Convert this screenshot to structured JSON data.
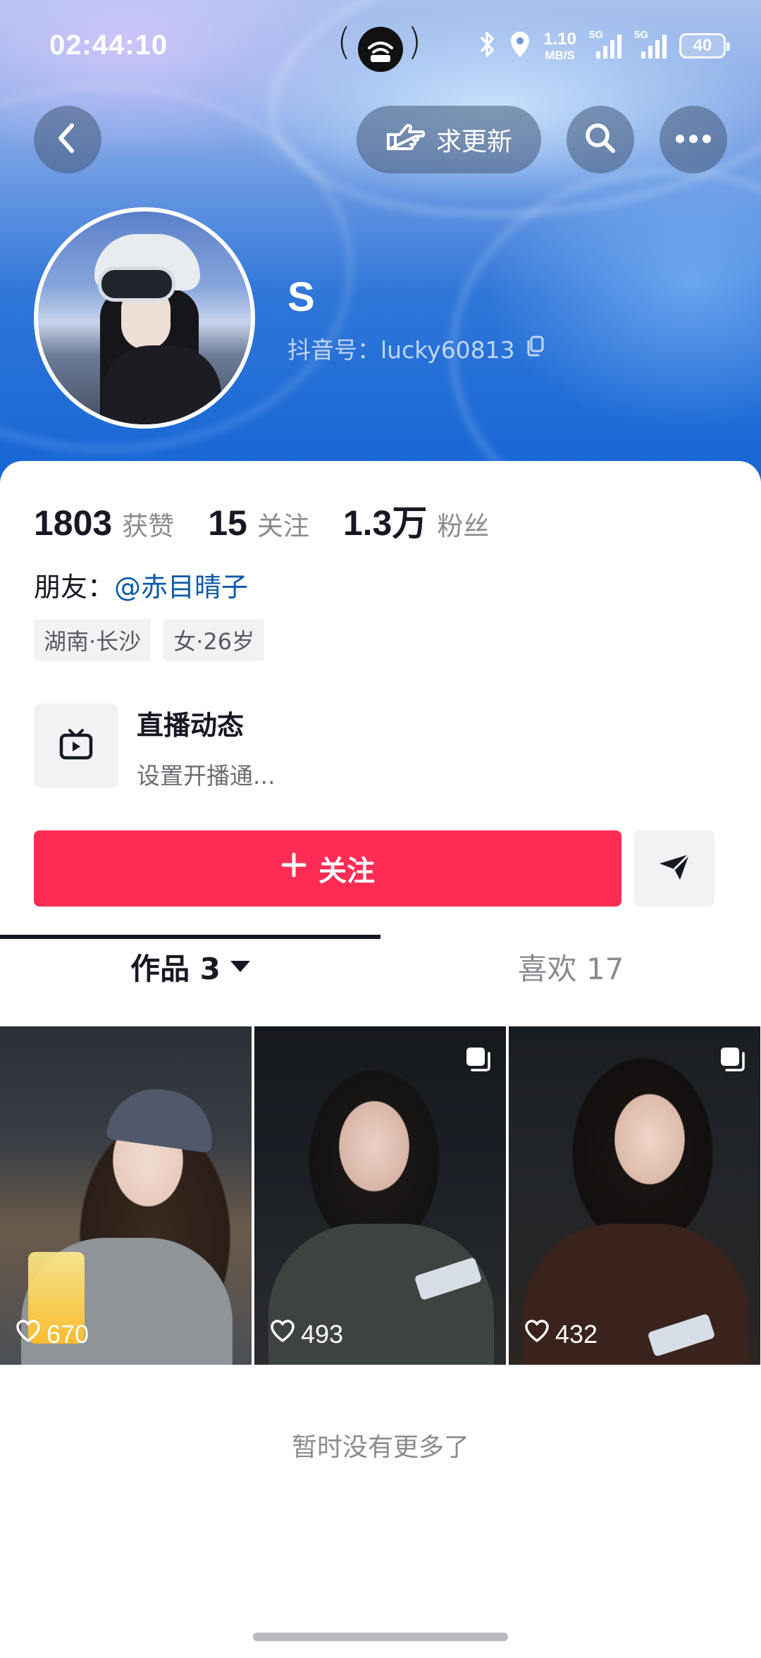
{
  "status_bar": {
    "time": "02:44:10",
    "net_speed_value": "1.10",
    "net_speed_unit": "MB/S",
    "sim1_tag": "5G",
    "sim2_tag": "5G",
    "battery": "40"
  },
  "header": {
    "update_button_label": "求更新"
  },
  "profile": {
    "nickname": "S",
    "account_id": "抖音号：lucky60813"
  },
  "stats": {
    "likes_count": "1803",
    "likes_label": "获赞",
    "following_count": "15",
    "following_label": "关注",
    "followers_count": "1.3万",
    "followers_label": "粉丝"
  },
  "friend": {
    "prefix": "朋友：",
    "name": "@赤目晴子"
  },
  "tags": [
    "湖南·长沙",
    "女·26岁"
  ],
  "live": {
    "title": "直播动态",
    "subtitle": "设置开播通..."
  },
  "actions": {
    "follow_label": "关注"
  },
  "tabs": {
    "works_label": "作品 3",
    "likes_label": "喜欢 17"
  },
  "videos": [
    {
      "likes": "670",
      "multi": false
    },
    {
      "likes": "493",
      "multi": true
    },
    {
      "likes": "432",
      "multi": true
    }
  ],
  "footer": {
    "no_more_text": "暂时没有更多了"
  },
  "colors": {
    "follow_button": "#fe2c55",
    "friend_link": "#0b5aa8"
  }
}
